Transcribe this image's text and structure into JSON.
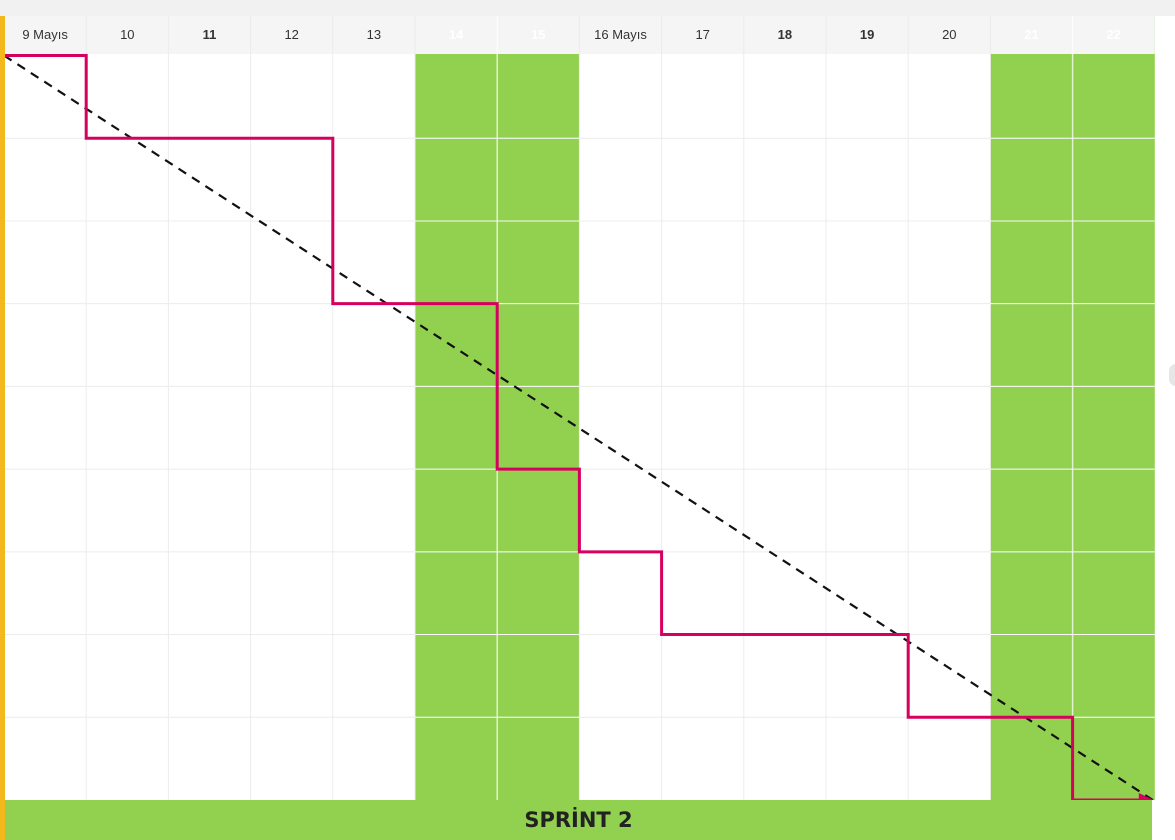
{
  "chart_data": {
    "type": "line",
    "title": "",
    "xlabel": "",
    "ylabel": "",
    "categories": [
      "9 Mayıs",
      "10",
      "11",
      "12",
      "13",
      "14",
      "15",
      "16 Mayıs",
      "17",
      "18",
      "19",
      "20",
      "21",
      "22"
    ],
    "bold_categories": [
      "11",
      "18",
      "19"
    ],
    "weekend_categories": [
      "14",
      "15",
      "21",
      "22"
    ],
    "row_count": 9,
    "ylim": [
      0,
      9
    ],
    "grid": true,
    "series": [
      {
        "style": "solid-step",
        "color": "#d6005e",
        "values": [
          9,
          8,
          8,
          8,
          6,
          6,
          4,
          3,
          2,
          2,
          2,
          1,
          1,
          0
        ]
      },
      {
        "style": "dashed",
        "color": "#111111",
        "x_start": 0,
        "x_end": 14,
        "y_start": 9,
        "y_end": 0
      }
    ],
    "banner": "SPRİNT 2"
  },
  "colors": {
    "weekend_fill": "#92d050",
    "header_bg": "#f5f5f5",
    "grid_line": "#ececec",
    "left_accent": "#f3b81c",
    "header_text": "#333333",
    "weekend_text": "#ffffff"
  }
}
